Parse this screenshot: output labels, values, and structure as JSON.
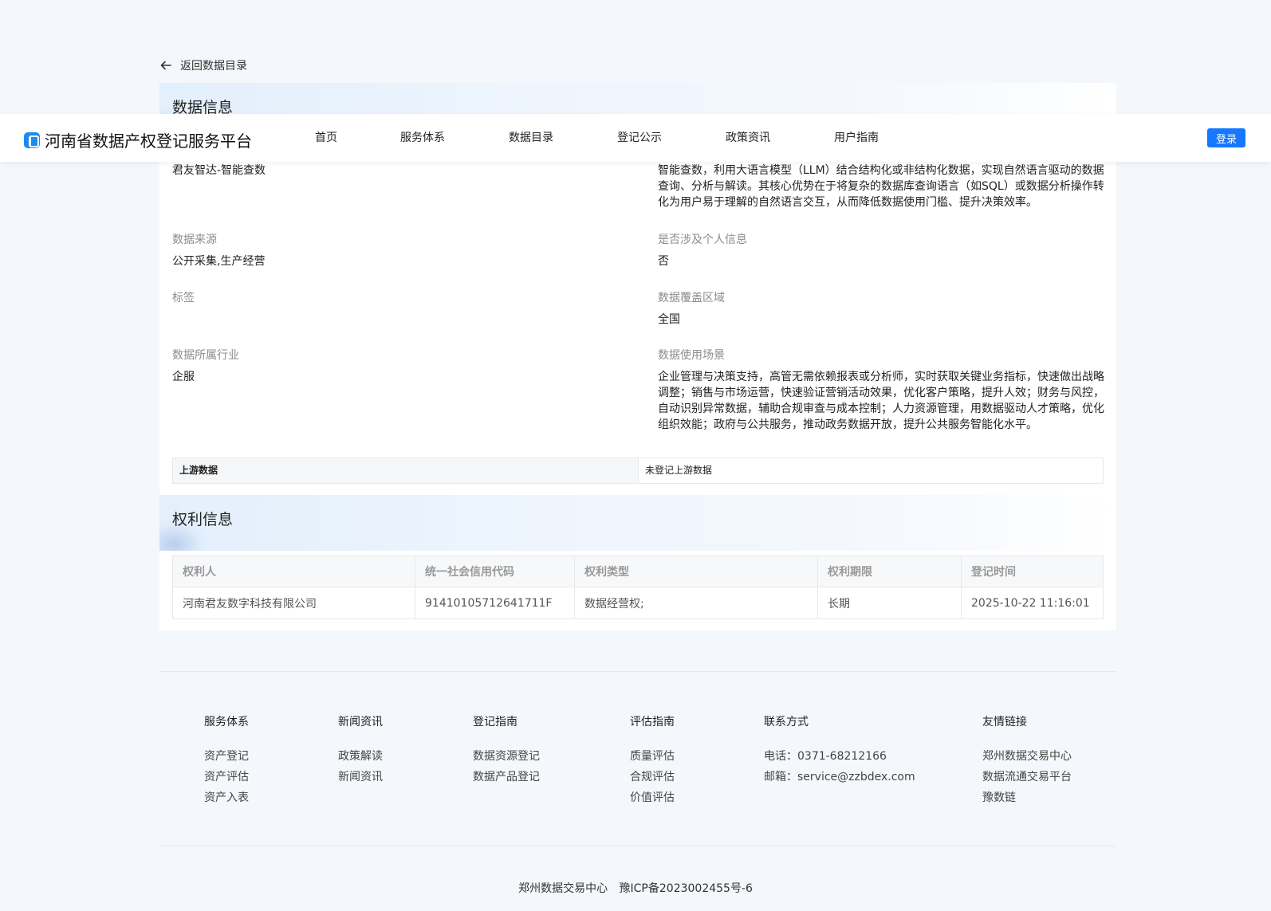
{
  "header": {
    "platform_title": "河南省数据产权登记服务平台",
    "nav": [
      "首页",
      "服务体系",
      "数据目录",
      "登记公示",
      "政策资讯",
      "用户指南"
    ],
    "login_label": "登录"
  },
  "back_link": "返回数据目录",
  "data_info": {
    "section_title": "数据信息",
    "name_value": "君友智达-智能查数",
    "description_value": "智能查数，利用大语言模型（LLM）结合结构化或非结构化数据，实现自然语言驱动的数据查询、分析与解读。其核心优势在于将复杂的数据库查询语言（如SQL）或数据分析操作转化为用户易于理解的自然语言交互，从而降低数据使用门槛、提升决策效率。",
    "source_label": "数据来源",
    "source_value": "公开采集,生产经营",
    "personal_info_label": "是否涉及个人信息",
    "personal_info_value": "否",
    "tags_label": "标签",
    "tags_value": "",
    "coverage_label": "数据覆盖区域",
    "coverage_value": "全国",
    "industry_label": "数据所属行业",
    "industry_value": "企服",
    "scenario_label": "数据使用场景",
    "scenario_value": "企业管理与决策支持，高管无需依赖报表或分析师，实时获取关键业务指标，快速做出战略调整；销售与市场运营，快速验证营销活动效果，优化客户策略，提升人效；财务与风控，自动识别异常数据，辅助合规审查与成本控制；人力资源管理，用数据驱动人才策略，优化组织效能；政府与公共服务，推动政务数据开放，提升公共服务智能化水平。",
    "upstream_label": "上游数据",
    "upstream_value": "未登记上游数据"
  },
  "rights_info": {
    "section_title": "权利信息",
    "columns": [
      "权利人",
      "统一社会信用代码",
      "权利类型",
      "权利期限",
      "登记时间"
    ],
    "rows": [
      [
        "河南君友数字科技有限公司",
        "91410105712641711F",
        "数据经营权;",
        "长期",
        "2025-10-22 11:16:01"
      ]
    ]
  },
  "footer": {
    "columns": [
      {
        "heading": "服务体系",
        "items": [
          "资产登记",
          "资产评估",
          "资产入表"
        ]
      },
      {
        "heading": "新闻资讯",
        "items": [
          "政策解读",
          "新闻资讯"
        ]
      },
      {
        "heading": "登记指南",
        "items": [
          "数据资源登记",
          "数据产品登记"
        ]
      },
      {
        "heading": "评估指南",
        "items": [
          "质量评估",
          "合规评估",
          "价值评估"
        ]
      },
      {
        "heading": "联系方式",
        "items": [
          "电话：0371-68212166",
          "邮箱：service@zzbdex.com"
        ]
      },
      {
        "heading": "友情链接",
        "items": [
          "郑州数据交易中心",
          "数据流通交易平台",
          "豫数链"
        ]
      }
    ],
    "copyright_org": "郑州数据交易中心",
    "icp": "豫ICP备2023002455号-6"
  }
}
